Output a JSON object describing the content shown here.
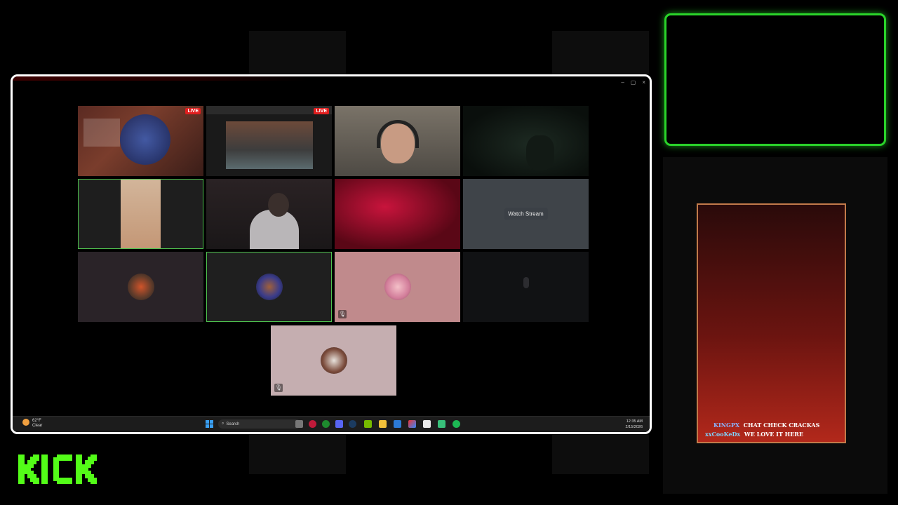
{
  "brand": {
    "logo_text": "KICK",
    "color": "#53fc18"
  },
  "window": {
    "controls": [
      "–",
      "▢",
      "×"
    ]
  },
  "tiles": {
    "watch_stream_label": "Watch Stream",
    "live_badge": "LIVE"
  },
  "taskbar": {
    "weather_temp": "62°F",
    "weather_cond": "Clear",
    "search_label": "Search",
    "time": "12:35 AM",
    "date": "2/15/2026"
  },
  "chat": {
    "messages": [
      {
        "user": "KINGPX",
        "text": "CHAT CHECK CRACKAS",
        "user_color": "#8ab4ff"
      },
      {
        "user": "xxCooKeDx",
        "text": "WE LOVE IT HERE",
        "user_color": "#7fd4ff"
      }
    ]
  },
  "colors": {
    "accent_green": "#2ad32a",
    "active_tile_border": "#4ec24e",
    "live_red": "#e01e1e"
  }
}
